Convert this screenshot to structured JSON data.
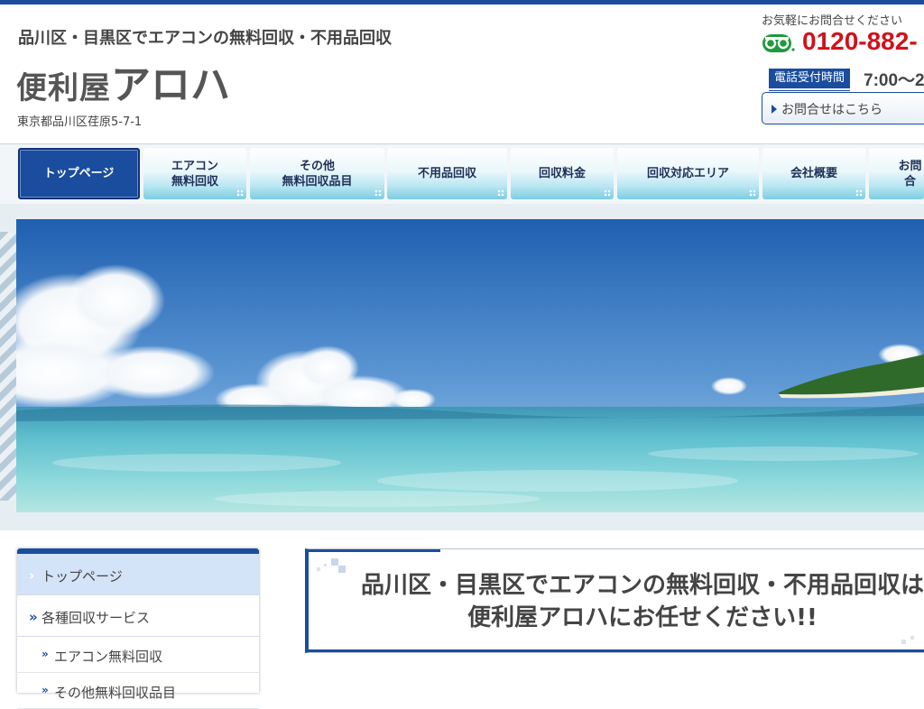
{
  "header": {
    "tagline": "品川区・目黒区でエアコンの無料回収・不用品回収",
    "logo_kanji": "便利屋",
    "logo_kana": "アロハ",
    "address": "東京都品川区荏原5-7-1"
  },
  "contact": {
    "lead": "お気軽にお問合せください",
    "freedial_icon": "freedial-icon",
    "phone": "0120-882-",
    "hours_label": "電話受付時間",
    "hours_value": "7:00～2",
    "contact_button": "お問合せはこちら"
  },
  "nav": {
    "items": [
      {
        "label": "トップページ"
      },
      {
        "label": "エアコン\n無料回収"
      },
      {
        "label": "その他\n無料回収品目"
      },
      {
        "label": "不用品回収"
      },
      {
        "label": "回収料金"
      },
      {
        "label": "回収対応エリア"
      },
      {
        "label": "会社概要"
      },
      {
        "label": "お問合"
      }
    ]
  },
  "sidebar": {
    "items": [
      {
        "label": "トップページ"
      },
      {
        "label": "各種回収サービス"
      }
    ],
    "subitems": [
      {
        "label": "エアコン無料回収"
      },
      {
        "label": "その他無料回収品目"
      }
    ]
  },
  "main": {
    "headline_line1": "品川区・目黒区でエアコンの無料回収・不用品回収は",
    "headline_line2": "便利屋アロハにお任せください!!"
  },
  "colors": {
    "brand_blue": "#1a4d9e",
    "phone_red": "#d0121b"
  }
}
